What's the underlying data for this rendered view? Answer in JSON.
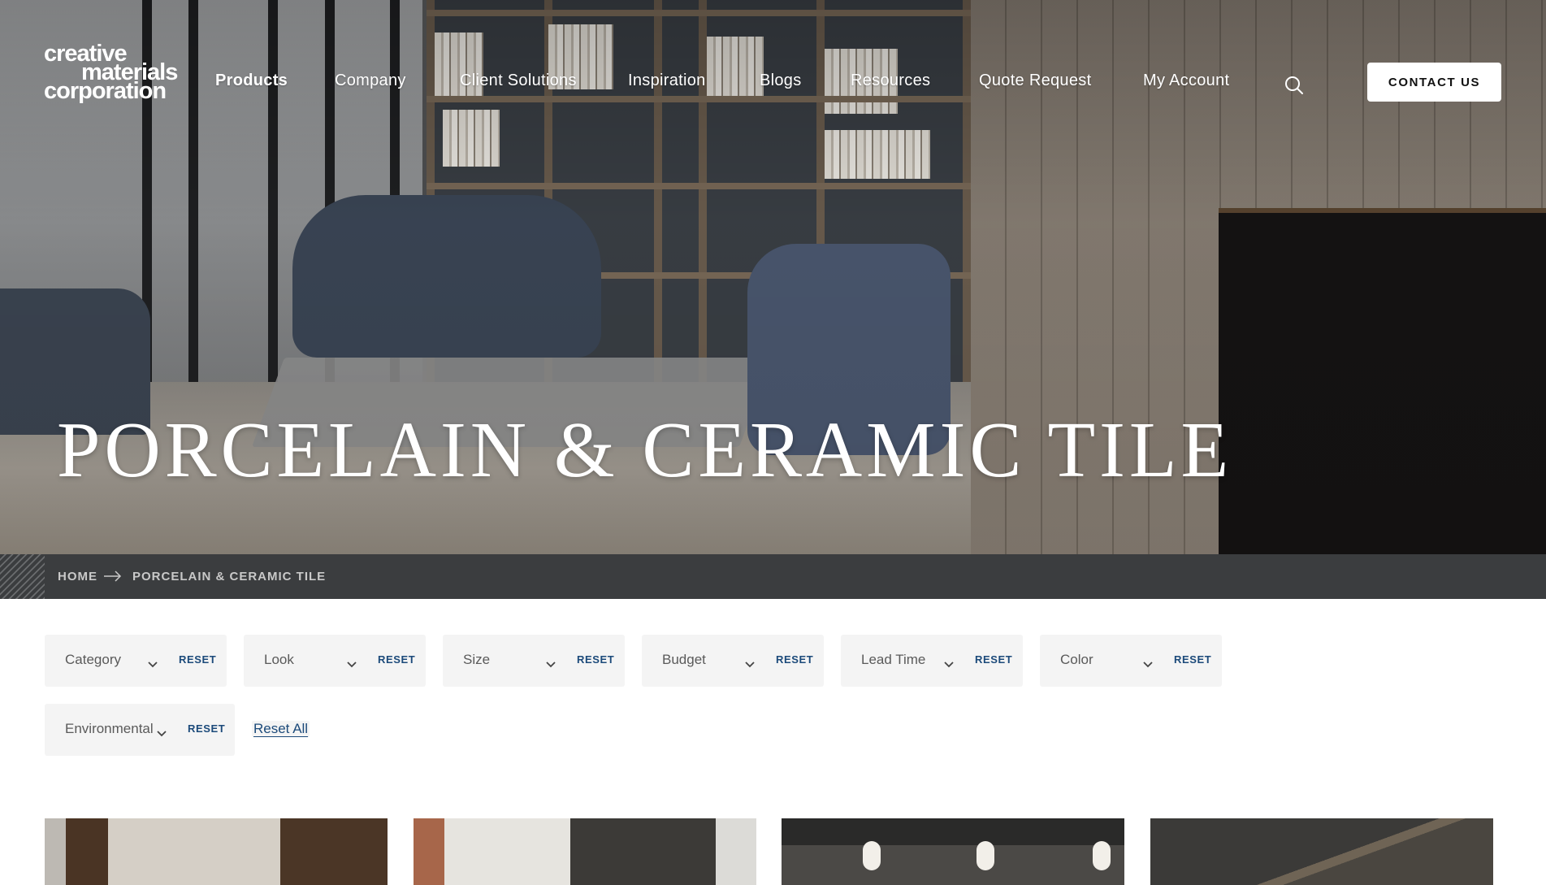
{
  "brand": {
    "logo_lines": [
      "creative",
      "materials",
      "corporation"
    ]
  },
  "nav": {
    "items": [
      {
        "label": "Products",
        "active": true
      },
      {
        "label": "Company",
        "active": false
      },
      {
        "label": "Client Solutions",
        "active": false
      },
      {
        "label": "Inspiration",
        "active": false
      },
      {
        "label": "Blogs",
        "active": false
      },
      {
        "label": "Resources",
        "active": false
      },
      {
        "label": "Quote Request",
        "active": false
      },
      {
        "label": "My Account",
        "active": false
      }
    ],
    "search_icon": "search-icon",
    "contact_label": "CONTACT US"
  },
  "hero": {
    "title": "PORCELAIN & CERAMIC TILE"
  },
  "breadcrumb": {
    "items": [
      "HOME",
      "PORCELAIN & CERAMIC TILE"
    ],
    "separator_icon": "arrow-right-icon"
  },
  "filters": {
    "items": [
      {
        "label": "Category",
        "reset": "RESET"
      },
      {
        "label": "Look",
        "reset": "RESET"
      },
      {
        "label": "Size",
        "reset": "RESET"
      },
      {
        "label": "Budget",
        "reset": "RESET"
      },
      {
        "label": "Lead Time",
        "reset": "RESET"
      },
      {
        "label": "Color",
        "reset": "RESET"
      },
      {
        "label": "Environmental",
        "reset": "RESET"
      }
    ],
    "reset_all": "Reset All"
  },
  "colors": {
    "accent": "#1c4a7a",
    "breadcrumb_bg": "#3b3d3f",
    "filter_bg": "#f4f4f4"
  }
}
